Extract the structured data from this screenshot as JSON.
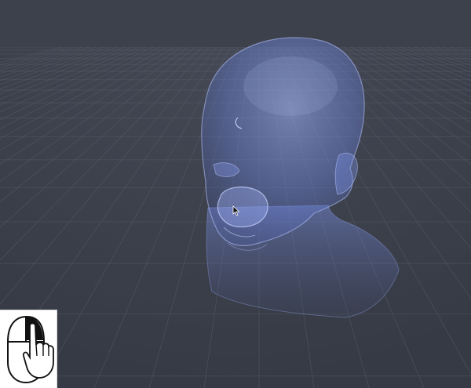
{
  "viewport": {
    "background_color": "#3d414c",
    "grid_color": "#5a5f6b",
    "model_color": "#8aa4ff",
    "model_highlight": "#c8d4ff"
  },
  "model": {
    "icon": "head-mesh-icon"
  },
  "mouse_hint": {
    "icon": "mouse-right-drag-icon",
    "background_color": "#ffffff",
    "stroke_color": "#111111"
  },
  "cursor": {
    "icon": "arrow-cursor-icon"
  }
}
